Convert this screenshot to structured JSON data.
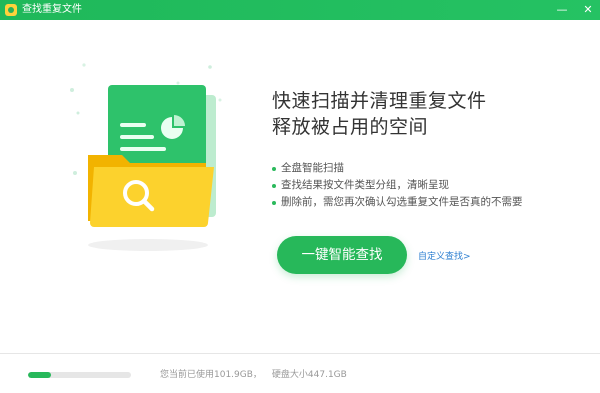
{
  "window": {
    "title": "查找重复文件",
    "controls": {
      "minimize": "—",
      "close": "✕"
    }
  },
  "main": {
    "headline_line1": "快速扫描并清理重复文件",
    "headline_line2": "释放被占用的空间",
    "features": [
      "全盘智能扫描",
      "查找结果按文件类型分组，清晰呈现",
      "删除前，需您再次确认勾选重复文件是否真的不需要"
    ],
    "scan_button": "一键智能查找",
    "custom_link": "自定义查找>"
  },
  "footer": {
    "used_text": "您当前已使用101.9GB，",
    "total_text": "硬盘大小447.1GB",
    "usage_fraction": 0.228
  },
  "colors": {
    "accent": "#27b85a",
    "link": "#2f80d1",
    "folder": "#f5c518"
  },
  "icons": {
    "app": "app-logo-icon",
    "illustration": "folder-search-illustration"
  }
}
